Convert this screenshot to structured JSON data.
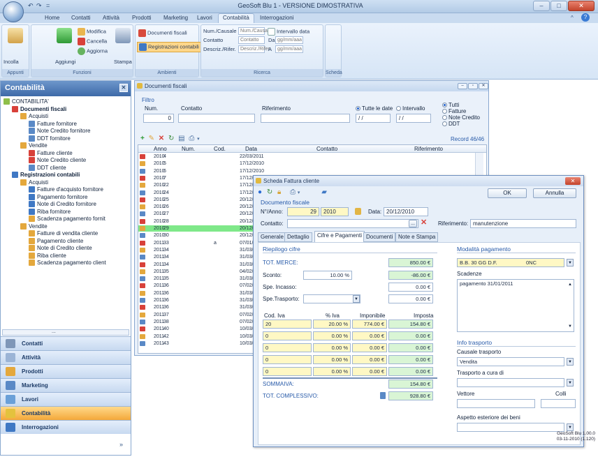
{
  "titlebar": {
    "title": "GeoSoft Blu 1 - VERSIONE DIMOSTRATIVA",
    "minimize": "–",
    "maximize": "□",
    "close": "✕",
    "qa": [
      "↶",
      "↷",
      "="
    ]
  },
  "tabs": [
    "Home",
    "Contatti",
    "Attività",
    "Prodotti",
    "Marketing",
    "Lavori",
    "Contabilità",
    "Interrogazioni"
  ],
  "ribbon": {
    "appunti": {
      "incolla": "Incolla",
      "label": "Appunti"
    },
    "funzioni": {
      "aggiungi": "Aggiungi",
      "modifica": "Modifica",
      "cancella": "Cancella",
      "aggiorna": "Aggiorna",
      "stampa": "Stampa",
      "label": "Funzioni"
    },
    "ambienti": {
      "documenti": "Documenti fiscali",
      "registrazioni": "Registrazioni contabili",
      "label": "Ambienti"
    },
    "ricerca": {
      "num_causale": "Num./Causale",
      "contatto": "Contatto",
      "descriz": "Descriz./Rifer.",
      "num_ph": "Num./Causal",
      "contatto_ph": "Contatto",
      "descriz_ph": "Descriz./Rifer",
      "intervallo": "Intervallo data",
      "da": "Da",
      "a": "A",
      "date_ph": "gg/mm/aaa",
      "label": "Ricerca"
    },
    "scheda": {
      "label": "Scheda"
    }
  },
  "nav": {
    "title": "Contabilità",
    "close": "✕",
    "tree": [
      {
        "label": "CONTABILITA'"
      },
      {
        "label": "Documenti fiscali"
      },
      {
        "label": "Acquisti"
      },
      {
        "label": "Fatture fornitore"
      },
      {
        "label": "Note Credito fornitore"
      },
      {
        "label": "DDT fornitore"
      },
      {
        "label": "Vendite"
      },
      {
        "label": "Fatture cliente"
      },
      {
        "label": "Note Credito cliente"
      },
      {
        "label": "DDT cliente"
      },
      {
        "label": "Registrazioni contabili"
      },
      {
        "label": "Acquisti"
      },
      {
        "label": "Fatture d'acquisto fornitore"
      },
      {
        "label": "Pagamento fornitore"
      },
      {
        "label": "Note di Credito fornitore"
      },
      {
        "label": "Riba fornitore"
      },
      {
        "label": "Scadenza pagamento fornit"
      },
      {
        "label": "Vendite"
      },
      {
        "label": "Fatture di vendita cliente"
      },
      {
        "label": "Pagamento cliente"
      },
      {
        "label": "Note di Credito cliente"
      },
      {
        "label": "Riba cliente"
      },
      {
        "label": "Scadenza pagamento client"
      }
    ],
    "scroll_label": "...",
    "buttons": [
      "Contatti",
      "Attività",
      "Prodotti",
      "Marketing",
      "Lavori",
      "Contabilità",
      "Interrogazioni"
    ],
    "chevron": "»"
  },
  "docwin": {
    "title": "Documenti fiscali",
    "filtro": "Filtro",
    "num_label": "Num.",
    "num_value": "0",
    "contatto_label": "Contatto",
    "riferimento_label": "Riferimento",
    "tutte_date": "Tutte le date",
    "intervallo": "Intervallo",
    "date1": "/ /",
    "date2": "/ /",
    "tipo": [
      "Tutti",
      "Fatture",
      "Note Credito",
      "DDT"
    ],
    "record": "Record 46/46",
    "columns": [
      "Anno",
      "Num.",
      "Cod.",
      "Data",
      "Contatto",
      "Riferimento"
    ],
    "rows": [
      {
        "anno": "2010",
        "num": "4",
        "cod": "",
        "data": "22/03/2011"
      },
      {
        "anno": "2010",
        "num": "5",
        "cod": "",
        "data": "17/12/2010"
      },
      {
        "anno": "2010",
        "num": "6",
        "cod": "",
        "data": "17/12/2010"
      },
      {
        "anno": "2010",
        "num": "7",
        "cod": "",
        "data": "17/12/2010"
      },
      {
        "anno": "2010",
        "num": "22",
        "cod": "",
        "data": "17/12/2010"
      },
      {
        "anno": "2010",
        "num": "24",
        "cod": "",
        "data": "17/12/2010"
      },
      {
        "anno": "2010",
        "num": "25",
        "cod": "",
        "data": "20/12/2010"
      },
      {
        "anno": "2010",
        "num": "26",
        "cod": "",
        "data": "20/12/2010"
      },
      {
        "anno": "2010",
        "num": "27",
        "cod": "",
        "data": "20/12/2010"
      },
      {
        "anno": "2010",
        "num": "28",
        "cod": "",
        "data": "20/12/2010"
      },
      {
        "anno": "2010",
        "num": "29",
        "cod": "",
        "data": "20/12/2010"
      },
      {
        "anno": "2010",
        "num": "30",
        "cod": "",
        "data": "20/12/2010"
      },
      {
        "anno": "2011",
        "num": "33",
        "cod": "a",
        "data": "07/01/2011"
      },
      {
        "anno": "2011",
        "num": "34",
        "cod": "",
        "data": "31/03/2011"
      },
      {
        "anno": "2011",
        "num": "34",
        "cod": "",
        "data": "31/03/2011"
      },
      {
        "anno": "2011",
        "num": "34",
        "cod": "",
        "data": "31/03/2011"
      },
      {
        "anno": "2011",
        "num": "35",
        "cod": "",
        "data": "04/02/2011"
      },
      {
        "anno": "2011",
        "num": "35",
        "cod": "",
        "data": "31/03/2011"
      },
      {
        "anno": "2011",
        "num": "36",
        "cod": "",
        "data": "07/02/2011"
      },
      {
        "anno": "2011",
        "num": "36",
        "cod": "",
        "data": "31/03/2011"
      },
      {
        "anno": "2011",
        "num": "36",
        "cod": "",
        "data": "31/03/2011"
      },
      {
        "anno": "2011",
        "num": "36",
        "cod": "",
        "data": "31/03/2011"
      },
      {
        "anno": "2011",
        "num": "37",
        "cod": "",
        "data": "07/02/2011"
      },
      {
        "anno": "2011",
        "num": "38",
        "cod": "",
        "data": "07/02/2011"
      },
      {
        "anno": "2011",
        "num": "40",
        "cod": "",
        "data": "10/03/2011"
      },
      {
        "anno": "2011",
        "num": "42",
        "cod": "",
        "data": "10/03/2011"
      },
      {
        "anno": "2011",
        "num": "43",
        "cod": "",
        "data": "10/03/2011"
      }
    ]
  },
  "scheda": {
    "title": "Scheda Fattura cliente",
    "ok": "OK",
    "annulla": "Annulla",
    "doc_fiscale": "Documento fiscale",
    "nanno_label": "N°/Anno:",
    "num": "29",
    "anno": "2010",
    "data_label": "Data:",
    "data": "20/12/2010",
    "contatto_label": "Contatto:",
    "contatto_btn": "...",
    "riferimento_label": "Riferimento:",
    "riferimento": "manutenzione",
    "tabs": [
      "Generale",
      "Dettaglio",
      "Cifre e Pagamenti",
      "Documenti",
      "Note e Stampa"
    ],
    "riepilogo": "Riepilogo cifre",
    "tot_merce_label": "TOT. MERCE:",
    "tot_merce": "850.00 €",
    "sconto_label": "Sconto:",
    "sconto_pct": "10.00 %",
    "sconto": "-86.00 €",
    "incasso_label": "Spe. Incasso:",
    "incasso": "0.00 €",
    "trasporto_label": "Spe.Trasporto:",
    "trasporto": "0.00 €",
    "iva_headers": [
      "Cod. Iva",
      "% Iva",
      "Imponibile",
      "Imposta"
    ],
    "iva_rows": [
      {
        "cod": "20",
        "pct": "20.00 %",
        "imp": "774.00 €",
        "imposta": "154.80 €"
      },
      {
        "cod": "0",
        "pct": "0.00 %",
        "imp": "0.00 €",
        "imposta": "0.00 €"
      },
      {
        "cod": "0",
        "pct": "0.00 %",
        "imp": "0.00 €",
        "imposta": "0.00 €"
      },
      {
        "cod": "0",
        "pct": "0.00 %",
        "imp": "0.00 €",
        "imposta": "0.00 €"
      },
      {
        "cod": "0",
        "pct": "0.00 %",
        "imp": "0.00 €",
        "imposta": "0.00 €"
      }
    ],
    "sommaiva_label": "SOMMAIVA:",
    "sommaiva": "154.80 €",
    "tot_compl_label": "TOT. COMPLESSIVO:",
    "tot_compl": "928.80 €",
    "modalita": "Modalità pagamento",
    "modalita_value": "B.B. 30 GG D.F.",
    "modalita_code": "0NC",
    "scadenze": "Scadenze",
    "scadenza_text": "pagamento 31/01/2011",
    "info_trasporto": "Info trasporto",
    "causale_label": "Causale trasporto",
    "causale": "Vendita",
    "trasp_cura_label": "Trasporto a cura di",
    "vettore_label": "Vettore",
    "colli_label": "Colli",
    "aspetto_label": "Aspetto esteriore dei beni"
  },
  "footer": {
    "line1": "GeoSoft Blu 1.00.0",
    "line2": "03-11-2010 (1.120)"
  },
  "colors": {
    "accent": "#2659a8",
    "selected_row": "#7fe889",
    "nav_selected": "#f4a83a"
  }
}
